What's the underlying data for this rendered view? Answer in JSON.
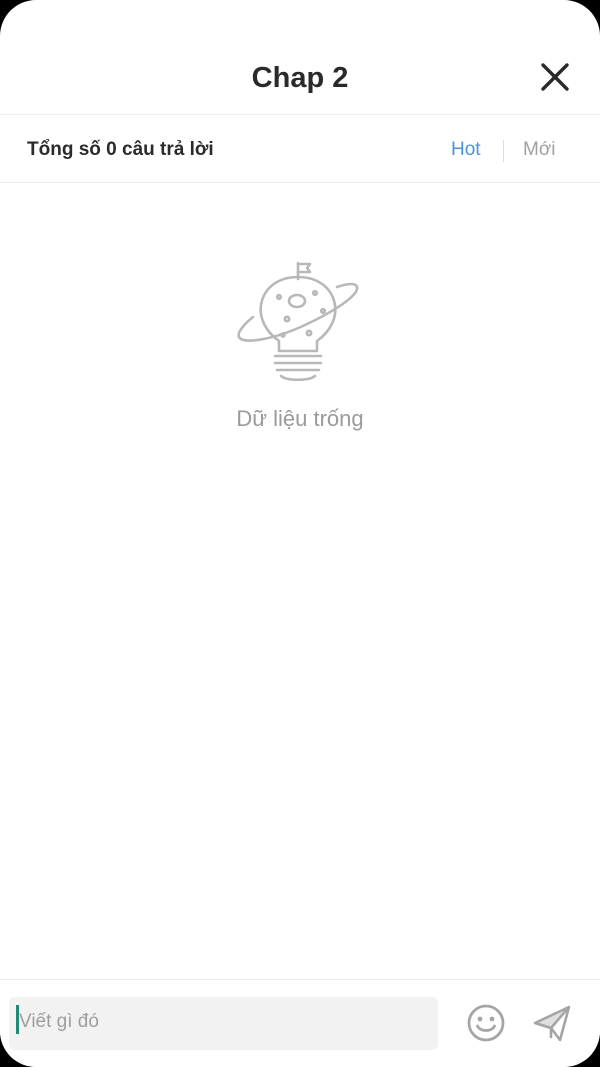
{
  "header": {
    "title": "Chap 2",
    "close_icon": "close-icon"
  },
  "filter": {
    "count_label": "Tổng số 0 câu trả lời",
    "tabs": [
      {
        "label": "Hot",
        "active": true
      },
      {
        "label": "Mới",
        "active": false
      }
    ]
  },
  "empty_state": {
    "icon": "lightbulb-planet-icon",
    "text": "Dữ liệu trống"
  },
  "composer": {
    "placeholder": "Viết gì đó",
    "emoji_icon": "smiley-icon",
    "send_icon": "send-icon"
  },
  "colors": {
    "accent": "#4a94d8",
    "caret": "#1f8a74",
    "muted": "#9a9a9a"
  }
}
